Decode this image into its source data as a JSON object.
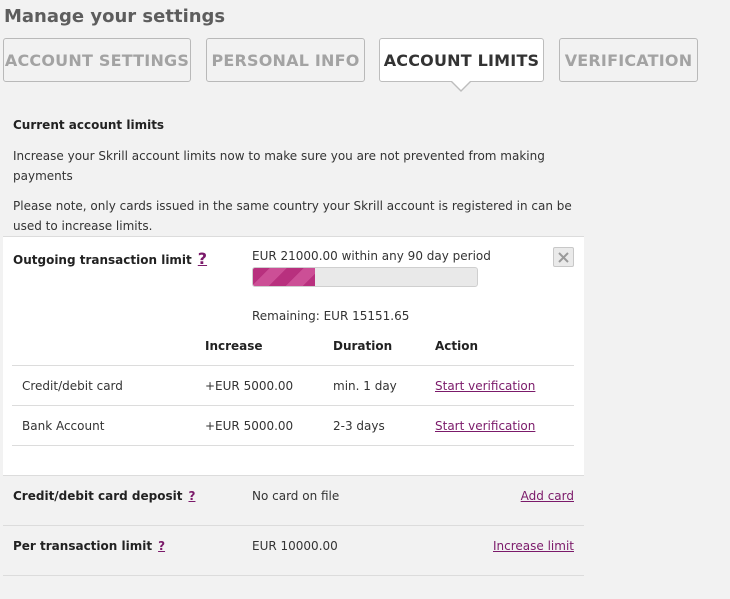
{
  "page": {
    "title": "Manage your settings"
  },
  "tabs": [
    {
      "label": "ACCOUNT SETTINGS",
      "active": false
    },
    {
      "label": "PERSONAL INFO",
      "active": false
    },
    {
      "label": "ACCOUNT LIMITS",
      "active": true
    },
    {
      "label": "VERIFICATION",
      "active": false
    }
  ],
  "intro": {
    "heading": "Current account limits",
    "line1": "Increase your Skrill account limits now to make sure you are not prevented from making payments",
    "line2": "Please note, only cards issued in the same country your Skrill account is registered in can be used to increase limits."
  },
  "outgoing": {
    "label": "Outgoing transaction limit",
    "help": "?",
    "limit_text": "EUR 21000.00 within any 90 day period",
    "used_fraction": 0.278,
    "remaining_text": "Remaining: EUR 15151.65",
    "close_icon": "close-icon",
    "table": {
      "headers": {
        "increase": "Increase",
        "duration": "Duration",
        "action": "Action"
      },
      "rows": [
        {
          "method": "Credit/debit card",
          "increase": "+EUR 5000.00",
          "duration": "min. 1 day",
          "action": "Start verification"
        },
        {
          "method": "Bank Account",
          "increase": "+EUR 5000.00",
          "duration": "2-3 days",
          "action": "Start verification"
        }
      ]
    }
  },
  "card_deposit": {
    "label": "Credit/debit card deposit",
    "help": "?",
    "value": "No card on file",
    "action": "Add card"
  },
  "per_transaction": {
    "label": "Per transaction limit",
    "help": "?",
    "value": "EUR 10000.00",
    "action": "Increase limit"
  },
  "colors": {
    "accent": "#7b1a6a",
    "progress": "#b8307e",
    "background": "#f2f2f2"
  }
}
